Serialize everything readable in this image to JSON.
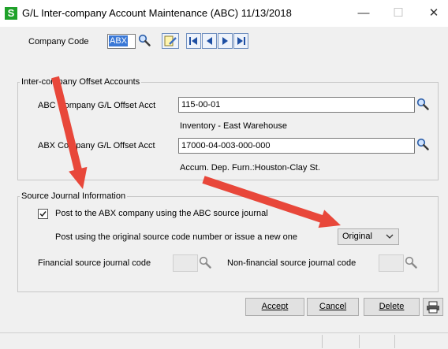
{
  "window": {
    "app_icon_letter": "S",
    "title": "G/L Inter-company Account Maintenance (ABC) 11/13/2018",
    "minimize": "—",
    "maximize": "☐",
    "close": "✕"
  },
  "header": {
    "company_code_label": "Company Code",
    "company_code_value": "ABX"
  },
  "offset_accounts": {
    "group_title": "Inter-company Offset Accounts",
    "abc_label": "ABC    Company G/L Offset Acct",
    "abc_value": "115-00-01",
    "abc_description": "Inventory - East Warehouse",
    "abx_label": "ABX  Company G/L Offset Acct",
    "abx_value": "17000-04-003-000-000",
    "abx_description": "Accum. Dep. Furn.:Houston-Clay St."
  },
  "source_journal": {
    "group_title": "Source Journal Information",
    "post_checkbox_checked": true,
    "post_checkbox_label": "Post to the  ABX    company using the  ABC    source journal",
    "post_using_label": "Post using the original source code number or issue a new one",
    "post_using_value": "Original",
    "financial_label": "Financial source journal code",
    "nonfinancial_label": "Non-financial source journal  code"
  },
  "buttons": {
    "accept": "Accept",
    "cancel": "Cancel",
    "delete": "Delete"
  },
  "colors": {
    "annotation_arrow": "#e8473a",
    "selection": "#3a78d6",
    "app_icon": "#1fa12a"
  }
}
